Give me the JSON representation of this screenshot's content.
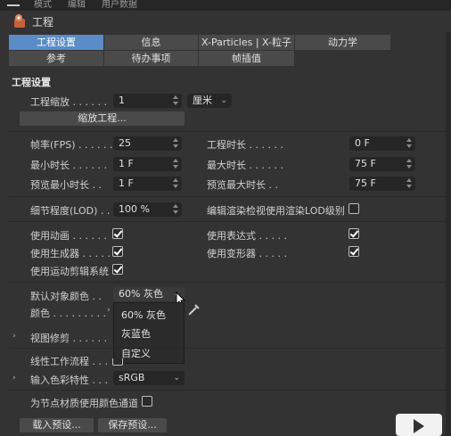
{
  "topbar": {
    "menu1": "模式",
    "menu2": "编辑",
    "menu3": "用户数据"
  },
  "window": {
    "title": "工程"
  },
  "tabs_row1": [
    "工程设置",
    "信息",
    "X-Particles | X-粒子",
    "动力学"
  ],
  "tabs_row2": [
    "参考",
    "待办事项",
    "帧插值"
  ],
  "section": {
    "title": "工程设置"
  },
  "project_scale": {
    "label": "工程缩放 . . . . . .",
    "value": "1",
    "unit": "厘米",
    "button": "缩放工程..."
  },
  "fps": {
    "label": "帧率(FPS) . . . . . .",
    "value": "25"
  },
  "project_time": {
    "label": "工程时长 . . . . . .",
    "value": "0 F"
  },
  "min_time": {
    "label": "最小时长 . . . . . .",
    "value": "1 F"
  },
  "max_time": {
    "label": "最大时长 . . . . . .",
    "value": "75 F"
  },
  "preview_min": {
    "label": "预览最小时长 . .",
    "value": "1 F"
  },
  "preview_max": {
    "label": "预览最大时长 . .",
    "value": "75 F"
  },
  "lod": {
    "label": "细节程度(LOD) . . .",
    "value": "100 %"
  },
  "editor_lod": {
    "label": "编辑渲染检视使用渲染LOD级别",
    "checked": false
  },
  "use_animation": {
    "label": "使用动画 . . . . . .",
    "checked": true
  },
  "use_expressions": {
    "label": "使用表达式 . . . . .",
    "checked": true
  },
  "use_generators": {
    "label": "使用生成器 . . . . .",
    "checked": true
  },
  "use_deformers": {
    "label": "使用变形器 . . . . .",
    "checked": true
  },
  "use_motion": {
    "label": "使用运动剪辑系统",
    "checked": true
  },
  "default_color": {
    "label": "默认对象颜色 . .",
    "value": "60% 灰色"
  },
  "color": {
    "label": "颜色 . . . . . . . . ."
  },
  "popup": {
    "items": [
      "60% 灰色",
      "灰蓝色",
      "自定义"
    ]
  },
  "viewport_clip": {
    "label": "视图修剪 . . . . . ."
  },
  "linear_workflow": {
    "label": "线性工作流程 . . ."
  },
  "input_color": {
    "label": "输入色彩特性 . . .",
    "value": "sRGB"
  },
  "node_material": {
    "label": "为节点材质使用颜色通道",
    "checked": false
  },
  "buttons": {
    "load": "载入预设...",
    "save": "保存预设..."
  },
  "colors": {
    "accent": "#5a8cc8",
    "bg": "#333333",
    "field": "#262626"
  }
}
